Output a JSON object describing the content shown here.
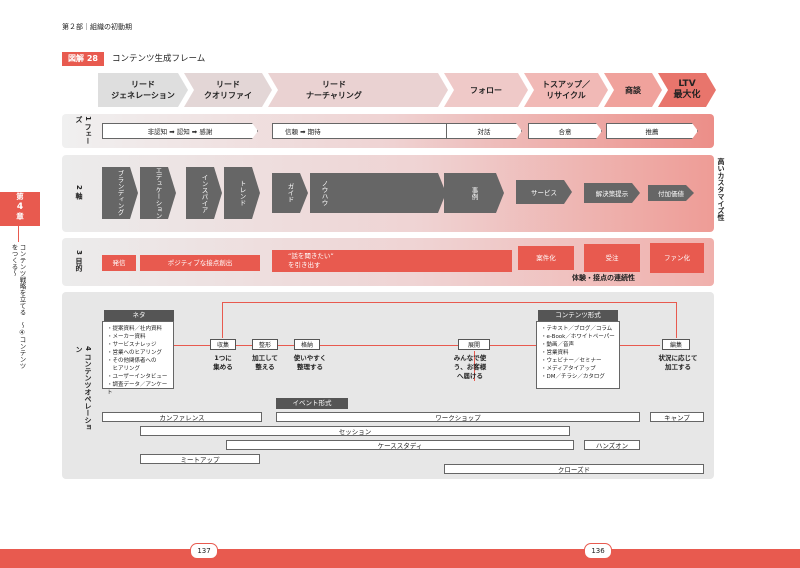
{
  "header": {
    "running_head": "第２部｜組織の初動期"
  },
  "figure": {
    "tag": "図解 28",
    "title": "コンテンツ生成フレーム"
  },
  "side": {
    "chapter_line1": "第",
    "chapter_line2": "4",
    "chapter_line3": "章",
    "tab_text": "コンテンツ戦略を立てる　〜④コンテンツをつくる〜"
  },
  "phases": [
    "リード\nジェネレーション",
    "リード\nクオリファイ",
    "リード\nナーチャリング",
    "フォロー",
    "トスアップ／\nリサイクル",
    "商談",
    "LTV\n最大化"
  ],
  "row1": {
    "label": "1 フェーズ",
    "items": [
      "非認知 ➡ 認知 ➡ 感謝",
      "信頼 ➡ 期待",
      "対話",
      "合意",
      "推薦"
    ]
  },
  "row2": {
    "label": "2 軸",
    "items": [
      "ブランディング",
      "エデュケーション",
      "インスパイア",
      "トレンド",
      "ガイド",
      "ノウハウ",
      "事例",
      "サービス",
      "解決策提示",
      "付加価値"
    ],
    "right_note": "高いカスタマイズ性"
  },
  "row3": {
    "label": "3 目的",
    "items": [
      "発信",
      "ポジティブな接点創出",
      "“話を聞きたい”\nを引き出す",
      "案件化",
      "受注",
      "ファン化"
    ],
    "note": "体験・接点の連続性"
  },
  "row4": {
    "label": "4 コンテンツオペレーション",
    "neta": {
      "head": "ネタ",
      "items": [
        "・提案資料／社内資料",
        "・メーカー資料",
        "・サービスナレッジ",
        "・営業へのヒアリング",
        "・その他関係者への",
        "　ヒアリング",
        "・ユーザーインタビュー",
        "・調査データ／アンケート"
      ]
    },
    "steps": [
      {
        "name": "収集",
        "desc": "1つに\n集める"
      },
      {
        "name": "整形",
        "desc": "加工して\n整える"
      },
      {
        "name": "格納",
        "desc": "使いやすく\n整理する"
      },
      {
        "name": "展開",
        "desc": "みんなで使\nう、お客様\nへ届ける"
      },
      {
        "name": "編集",
        "desc": "状況に応じて\n加工する"
      }
    ],
    "format": {
      "head": "コンテンツ形式",
      "items": [
        "・テキスト／ブログ／コラム",
        "・e-Book／ホワイトペーパー",
        "・動画／音声",
        "・営業資料",
        "・ウェビナー／セミナー",
        "・メディアタイアップ",
        "・DM／チラシ／カタログ"
      ]
    },
    "event_head": "イベント形式",
    "events": [
      "カンファレンス",
      "ワークショップ",
      "キャンプ",
      "セッション",
      "ケーススタディ",
      "ハンズオン",
      "ミートアップ",
      "クローズド"
    ]
  },
  "pages": {
    "left": "137",
    "right": "136"
  },
  "colors": {
    "accent": "#e85a4f",
    "pink": "#efcfd0",
    "gray": "#666666"
  }
}
